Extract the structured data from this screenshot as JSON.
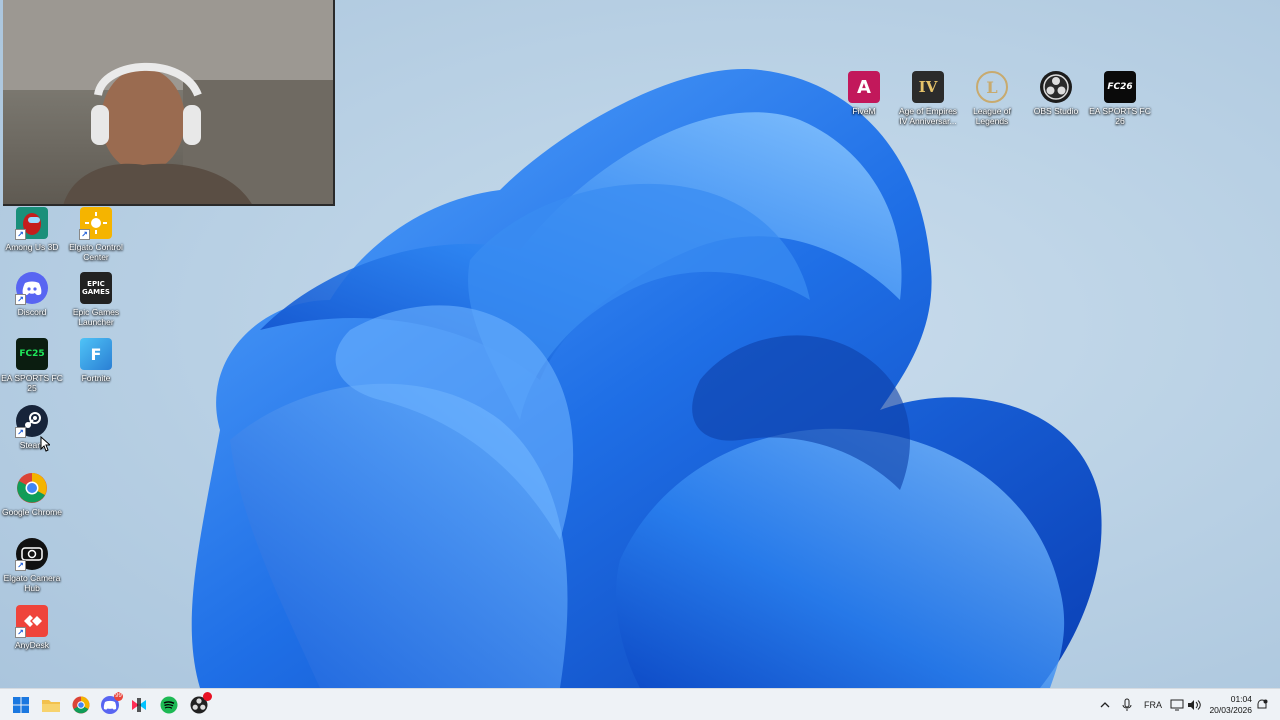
{
  "desktop": {
    "left_icons": [
      {
        "name": "among-us-icon",
        "label": "Among Us 3D"
      },
      {
        "name": "elgato-control-center-icon",
        "label": "Elgato Control Center"
      },
      {
        "name": "discord-icon",
        "label": "Discord"
      },
      {
        "name": "epic-games-icon",
        "label": "Epic Games Launcher",
        "glyph": "EPIC\nGAMES"
      },
      {
        "name": "ea-fc25-icon",
        "label": "EA SPORTS FC 25",
        "glyph": "FC25"
      },
      {
        "name": "fortnite-icon",
        "label": "Fortnite",
        "glyph": "F"
      },
      {
        "name": "steam-icon",
        "label": "Steam"
      },
      {
        "name": "chrome-icon",
        "label": "Google Chrome"
      },
      {
        "name": "elgato-camera-hub-icon",
        "label": "Elgato Camera Hub"
      },
      {
        "name": "anydesk-icon",
        "label": "AnyDesk"
      }
    ],
    "top_icons": [
      {
        "name": "fivem-icon",
        "label": "FiveM",
        "glyph": "A"
      },
      {
        "name": "aoe4-icon",
        "label": "Age of Empires IV Anniversar...",
        "glyph": "IV"
      },
      {
        "name": "league-icon",
        "label": "League of Legends",
        "glyph": "L"
      },
      {
        "name": "obs-icon",
        "label": "OBS Studio"
      },
      {
        "name": "ea-fc26-icon",
        "label": "EA SPORTS FC 26",
        "glyph": "FC26"
      }
    ]
  },
  "taskbar": {
    "apps": [
      "start-icon",
      "file-explorer-icon",
      "chrome-icon",
      "discord-icon",
      "capcut-icon",
      "spotify-icon",
      "obs-icon"
    ],
    "discord_badge": "99",
    "tray": {
      "language": "FRA",
      "time": "01:04",
      "date": "20/03/2026"
    }
  },
  "colors": {
    "wallpaper_bg": "#bcd3e6",
    "bloom_blue": "#1a6fe8",
    "taskbar": "#eef2f6"
  }
}
